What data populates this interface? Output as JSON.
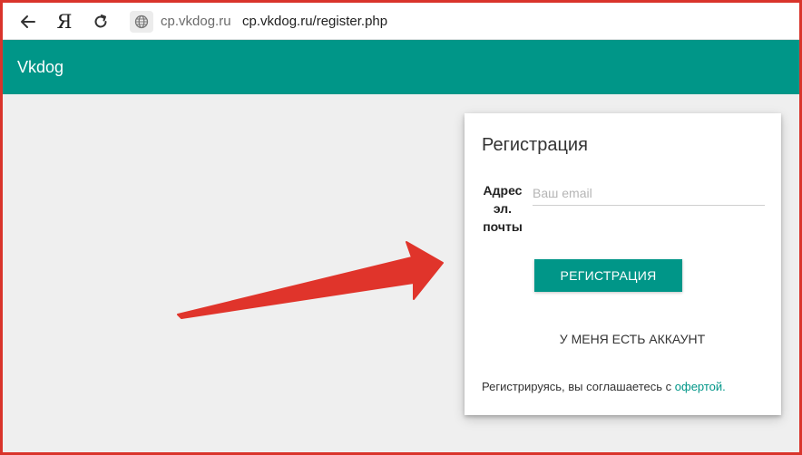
{
  "browser": {
    "yandex_glyph": "Я",
    "domain": "cp.vkdog.ru",
    "url": "cp.vkdog.ru/register.php",
    "icons": [
      "back-arrow-icon",
      "yandex-icon",
      "reload-icon",
      "globe-icon"
    ]
  },
  "header": {
    "title": "Vkdog",
    "color": "#009688"
  },
  "card": {
    "title": "Регистрация",
    "email_label": "Адрес эл. почты",
    "email_placeholder": "Ваш email",
    "email_value": "",
    "register_button": "РЕГИСТРАЦИЯ",
    "have_account_button": "У МЕНЯ ЕСТЬ АККАУНТ",
    "terms_text": "Регистрируясь, вы соглашаетесь с ",
    "terms_link": "офертой."
  },
  "annotation": {
    "arrow_color": "#e0342b",
    "frame_color": "#d9342b"
  }
}
